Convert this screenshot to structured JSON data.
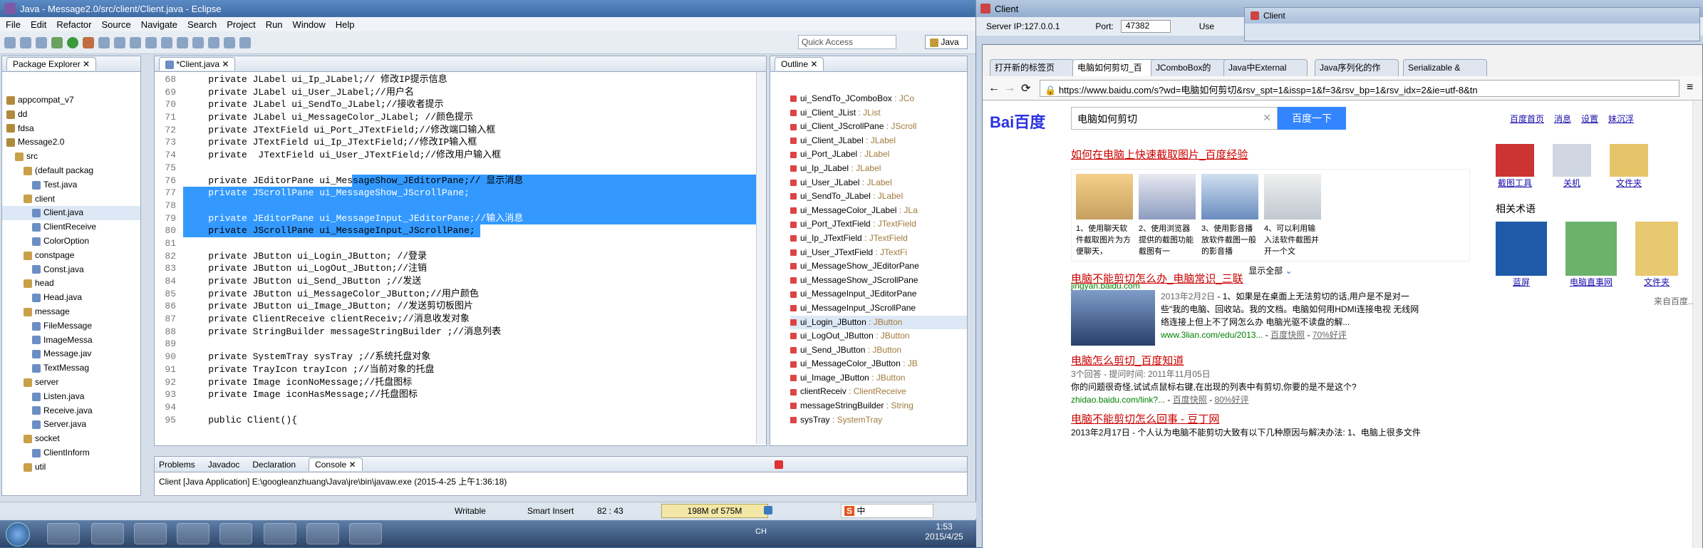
{
  "eclipse": {
    "title": "Java - Message2.0/src/client/Client.java - Eclipse",
    "menu": [
      "File",
      "Edit",
      "Refactor",
      "Source",
      "Navigate",
      "Search",
      "Project",
      "Run",
      "Window",
      "Help"
    ],
    "quick_access": "Quick Access",
    "perspective": "Java",
    "package_explorer": {
      "title": "Package Explorer",
      "items": [
        {
          "t": "appcompat_v7",
          "lvl": 0
        },
        {
          "t": "dd",
          "lvl": 0
        },
        {
          "t": "fdsa",
          "lvl": 0
        },
        {
          "t": "Message2.0",
          "lvl": 0
        },
        {
          "t": "src",
          "lvl": 1
        },
        {
          "t": "(default packag",
          "lvl": 2
        },
        {
          "t": "Test.java",
          "lvl": 3
        },
        {
          "t": "client",
          "lvl": 2
        },
        {
          "t": "Client.java",
          "lvl": 3
        },
        {
          "t": "ClientReceive",
          "lvl": 3
        },
        {
          "t": "ColorOption",
          "lvl": 3
        },
        {
          "t": "constpage",
          "lvl": 2
        },
        {
          "t": "Const.java",
          "lvl": 3
        },
        {
          "t": "head",
          "lvl": 2
        },
        {
          "t": "Head.java",
          "lvl": 3
        },
        {
          "t": "message",
          "lvl": 2
        },
        {
          "t": "FileMessage",
          "lvl": 3
        },
        {
          "t": "ImageMessa",
          "lvl": 3
        },
        {
          "t": "Message.jav",
          "lvl": 3
        },
        {
          "t": "TextMessag",
          "lvl": 3
        },
        {
          "t": "server",
          "lvl": 2
        },
        {
          "t": "Listen.java",
          "lvl": 3
        },
        {
          "t": "Receive.java",
          "lvl": 3
        },
        {
          "t": "Server.java",
          "lvl": 3
        },
        {
          "t": "socket",
          "lvl": 2
        },
        {
          "t": "ClientInform",
          "lvl": 3
        },
        {
          "t": "util",
          "lvl": 2
        }
      ]
    },
    "editor_tab": "*Client.java",
    "code": [
      {
        "n": "68",
        "t": "    private JLabel ui_Ip_JLabel;// 修改IP提示信息",
        "s": 0
      },
      {
        "n": "69",
        "t": "    private JLabel ui_User_JLabel;//用户名",
        "s": 0
      },
      {
        "n": "70",
        "t": "    private JLabel ui_SendTo_JLabel;//接收者提示",
        "s": 0
      },
      {
        "n": "71",
        "t": "    private JLabel ui_MessageColor_JLabel; //颜色提示",
        "s": 0
      },
      {
        "n": "72",
        "t": "    private JTextField ui_Port_JTextField;//修改端口输入框",
        "s": 0
      },
      {
        "n": "73",
        "t": "    private JTextField ui_Ip_JTextField;//修改IP输入框",
        "s": 0
      },
      {
        "n": "74",
        "t": "    private  JTextField ui_User_JTextField;//修改用户输入框",
        "s": 0
      },
      {
        "n": "75",
        "t": "",
        "s": 0
      },
      {
        "n": "76",
        "t": "    private JEditorPane ui_MessageShow_JEditorPane;// 显示消息",
        "s": 2
      },
      {
        "n": "77",
        "t": "    private JScrollPane ui_MessageShow_JScrollPane;",
        "s": 1
      },
      {
        "n": "78",
        "t": "",
        "s": 1
      },
      {
        "n": "79",
        "t": "    private JEditorPane ui_MessageInput_JEditorPane;//输入消息",
        "s": 1
      },
      {
        "n": "80",
        "t": "    private JScrollPane ui_MessageInput_JScrollPane;",
        "s": 3
      },
      {
        "n": "81",
        "t": "",
        "s": 0
      },
      {
        "n": "82",
        "t": "    private JButton ui_Login_JButton; //登录",
        "s": 0
      },
      {
        "n": "83",
        "t": "    private JButton ui_LogOut_JButton;//注销",
        "s": 0
      },
      {
        "n": "84",
        "t": "    private JButton ui_Send_JButton ;//发送",
        "s": 0
      },
      {
        "n": "85",
        "t": "    private JButton ui_MessageColor_JButton;//用户颜色",
        "s": 0
      },
      {
        "n": "86",
        "t": "    private JButton ui_Image_JButton; //发送剪切板图片",
        "s": 0
      },
      {
        "n": "87",
        "t": "    private ClientReceive clientReceiv;//消息收发对象",
        "s": 0
      },
      {
        "n": "88",
        "t": "    private StringBuilder messageStringBuilder ;//消息列表",
        "s": 0
      },
      {
        "n": "89",
        "t": "",
        "s": 0
      },
      {
        "n": "90",
        "t": "    private SystemTray sysTray ;//系统托盘对象",
        "s": 0
      },
      {
        "n": "91",
        "t": "    private TrayIcon trayIcon ;//当前对象的托盘",
        "s": 0
      },
      {
        "n": "92",
        "t": "    private Image iconNoMessage;//托盘图标",
        "s": 0
      },
      {
        "n": "93",
        "t": "    private Image iconHasMessage;//托盘图标",
        "s": 0
      },
      {
        "n": "94",
        "t": "",
        "s": 0
      },
      {
        "n": "95",
        "t": "    public Client(){",
        "s": 0
      }
    ],
    "outline": {
      "title": "Outline",
      "items": [
        {
          "n": "ui_SendTo_JComboBox",
          "ty": " : JCo"
        },
        {
          "n": "ui_Client_JList",
          "ty": " : JList"
        },
        {
          "n": "ui_Client_JScrollPane",
          "ty": " : JScroll"
        },
        {
          "n": "ui_Client_JLabel",
          "ty": " : JLabel"
        },
        {
          "n": "ui_Port_JLabel",
          "ty": " : JLabel"
        },
        {
          "n": "ui_Ip_JLabel",
          "ty": " : JLabel"
        },
        {
          "n": "ui_User_JLabel",
          "ty": " : JLabel"
        },
        {
          "n": "ui_SendTo_JLabel",
          "ty": " : JLabel"
        },
        {
          "n": "ui_MessageColor_JLabel",
          "ty": " : JLa"
        },
        {
          "n": "ui_Port_JTextField",
          "ty": " : JTextField"
        },
        {
          "n": "ui_Ip_JTextField",
          "ty": " : JTextField"
        },
        {
          "n": "ui_User_JTextField",
          "ty": " : JTextFi"
        },
        {
          "n": "ui_MessageShow_JEditorPane",
          "ty": ""
        },
        {
          "n": "ui_MessageShow_JScrollPane",
          "ty": ""
        },
        {
          "n": "ui_MessageInput_JEditorPane",
          "ty": ""
        },
        {
          "n": "ui_MessageInput_JScrollPane",
          "ty": ""
        },
        {
          "n": "ui_Login_JButton",
          "ty": " : JButton"
        },
        {
          "n": "ui_LogOut_JButton",
          "ty": " : JButton"
        },
        {
          "n": "ui_Send_JButton",
          "ty": " : JButton"
        },
        {
          "n": "ui_MessageColor_JButton",
          "ty": " : JB"
        },
        {
          "n": "ui_Image_JButton",
          "ty": " : JButton"
        },
        {
          "n": "clientReceiv",
          "ty": " : ClientReceive"
        },
        {
          "n": "messageStringBuilder",
          "ty": " : String"
        },
        {
          "n": "sysTray",
          "ty": " : SystemTray"
        }
      ]
    },
    "bottom_tabs": [
      "Problems",
      "Javadoc",
      "Declaration",
      "Console"
    ],
    "console_text": "Client [Java Application] E:\\googleanzhuang\\Java\\jre\\bin\\javaw.exe (2015-4-25 上午1:36:18)",
    "status": {
      "mode": "Writable",
      "insert": "Smart Insert",
      "pos": "82 : 43",
      "heap": "198M of 575M"
    },
    "tray": {
      "time": "1:53",
      "date": "2015/4/25",
      "ime": "中",
      "lang": "CH"
    }
  },
  "client_win": {
    "title": "Client",
    "server_ip_label": "Server IP:127.0.0.1",
    "port_label": "Port:",
    "port_value": "47382",
    "use_label": "Use"
  },
  "client_win2": {
    "title": "Client"
  },
  "chrome": {
    "tabs": [
      "打开新的标签页",
      "电脑如何剪切_百",
      "JComboBox的",
      "Java中External",
      "Java序列化的作",
      "Serializable &"
    ],
    "url": "https://www.baidu.com/s?wd=电脑如何剪切&rsv_spt=1&issp=1&f=3&rsv_bp=1&rsv_idx=2&ie=utf-8&tn",
    "logo": "Bai百度",
    "search_value": "电脑如何剪切",
    "search_button": "百度一下",
    "top_links": [
      "百度首页",
      "消息",
      "设置",
      "妹沉浮"
    ],
    "results": [
      {
        "title": "如何在电脑上快速截取图片_百度经验",
        "steps": [
          "1、使用聊天软件截取图片为方便聊天，",
          "2、使用浏览器提供的截图功能截图有一",
          "3、使用影音播放软件截图一般的影音播",
          "4、可以利用输入法软件截图并开一个文"
        ],
        "more": "显示全部",
        "url": "jingyan.baidu.com"
      },
      {
        "title": "电脑不能剪切怎么办_电脑常识_三联",
        "date": "2013年2月2日",
        "snip1": "- 1、如果是在桌面上无法剪切的话,用户是不是对一",
        "snip2": "些\"我的电脑、回收站。我的文档。电脑如何用HDMI连接电视 无线网",
        "snip3": "络连接上但上不了网怎么办 电脑光驱不读盘的解...",
        "url": "www.3lian.com/edu/2013...",
        "cache": "百度快照",
        "rate": "70%好评"
      },
      {
        "title": "电脑怎么剪切_百度知道",
        "meta": "3个回答 - 提问时间: 2011年11月05日",
        "snip": "你的问题很奇怪,试试点鼠标右键,在出现的列表中有剪切,你要的是不是这个?",
        "url": "zhidao.baidu.com/link?...",
        "cache": "百度快照",
        "rate": "80%好评"
      },
      {
        "title": "电脑不能剪切怎么回事 - 豆丁网",
        "snip": "2013年2月17日 - 个人认为电脑不能剪切大致有以下几种原因与解决办法: 1、电脑上很多文件"
      }
    ],
    "right": {
      "icons": [
        "截图工具",
        "关机",
        "文件夹"
      ],
      "related_title": "相关术语",
      "related": [
        "蓝屏",
        "电脑直事网",
        "文件夹"
      ],
      "source": "来自百度..."
    }
  }
}
